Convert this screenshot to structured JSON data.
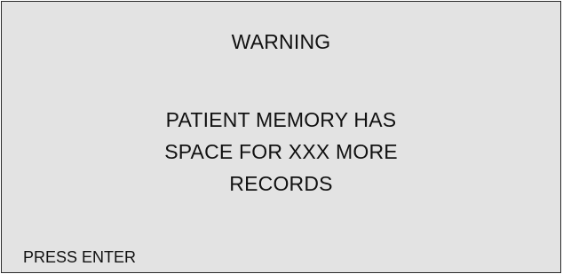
{
  "dialog": {
    "title": "WARNING",
    "message_lines": [
      "PATIENT MEMORY HAS",
      "SPACE FOR XXX MORE",
      "RECORDS"
    ],
    "prompt": "PRESS ENTER"
  },
  "colors": {
    "background": "#e3e3e3",
    "border": "#2b2b2b",
    "text": "#111111"
  }
}
